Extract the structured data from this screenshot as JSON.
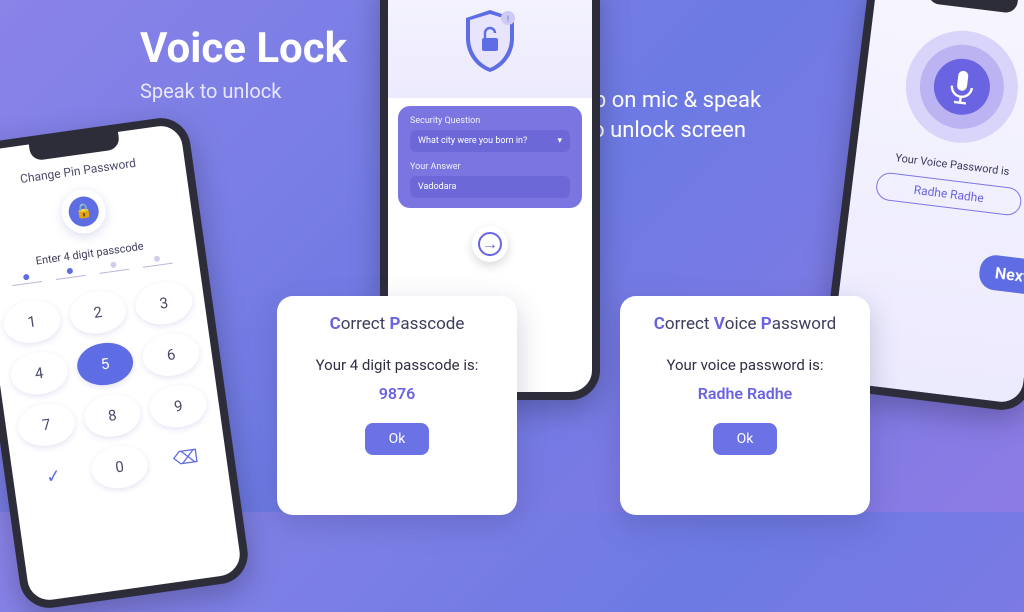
{
  "hero": {
    "title": "Voice Lock",
    "subtitle": "Speak to unlock"
  },
  "tagline": {
    "line1": "Tap on mic & speak",
    "line2": "to unlock screen"
  },
  "p1": {
    "header": "Change Pin Password",
    "prompt": "Enter 4 digit passcode",
    "filled_dots": 2,
    "keys": [
      "1",
      "2",
      "3",
      "4",
      "5",
      "6",
      "7",
      "8",
      "9",
      "✓",
      "0",
      "⌫"
    ],
    "active_key": "5"
  },
  "p2": {
    "sq_label": "Security Question",
    "sq_value": "What city were you born in?",
    "ans_label": "Your Answer",
    "ans_value": "Vadodara"
  },
  "p3": {
    "caption": "Your Voice Password is",
    "chip": "Radhe  Radhe",
    "next": "Next"
  },
  "card1": {
    "title_parts": [
      "C",
      "orrect ",
      "P",
      "asscode"
    ],
    "body": "Your 4 digit passcode is:",
    "value": "9876",
    "ok": "Ok"
  },
  "card2": {
    "title_parts": [
      "C",
      "orrect ",
      "V",
      "oice ",
      "P",
      "assword"
    ],
    "body": "Your voice password is:",
    "value": "Radhe Radhe",
    "ok": "Ok"
  }
}
